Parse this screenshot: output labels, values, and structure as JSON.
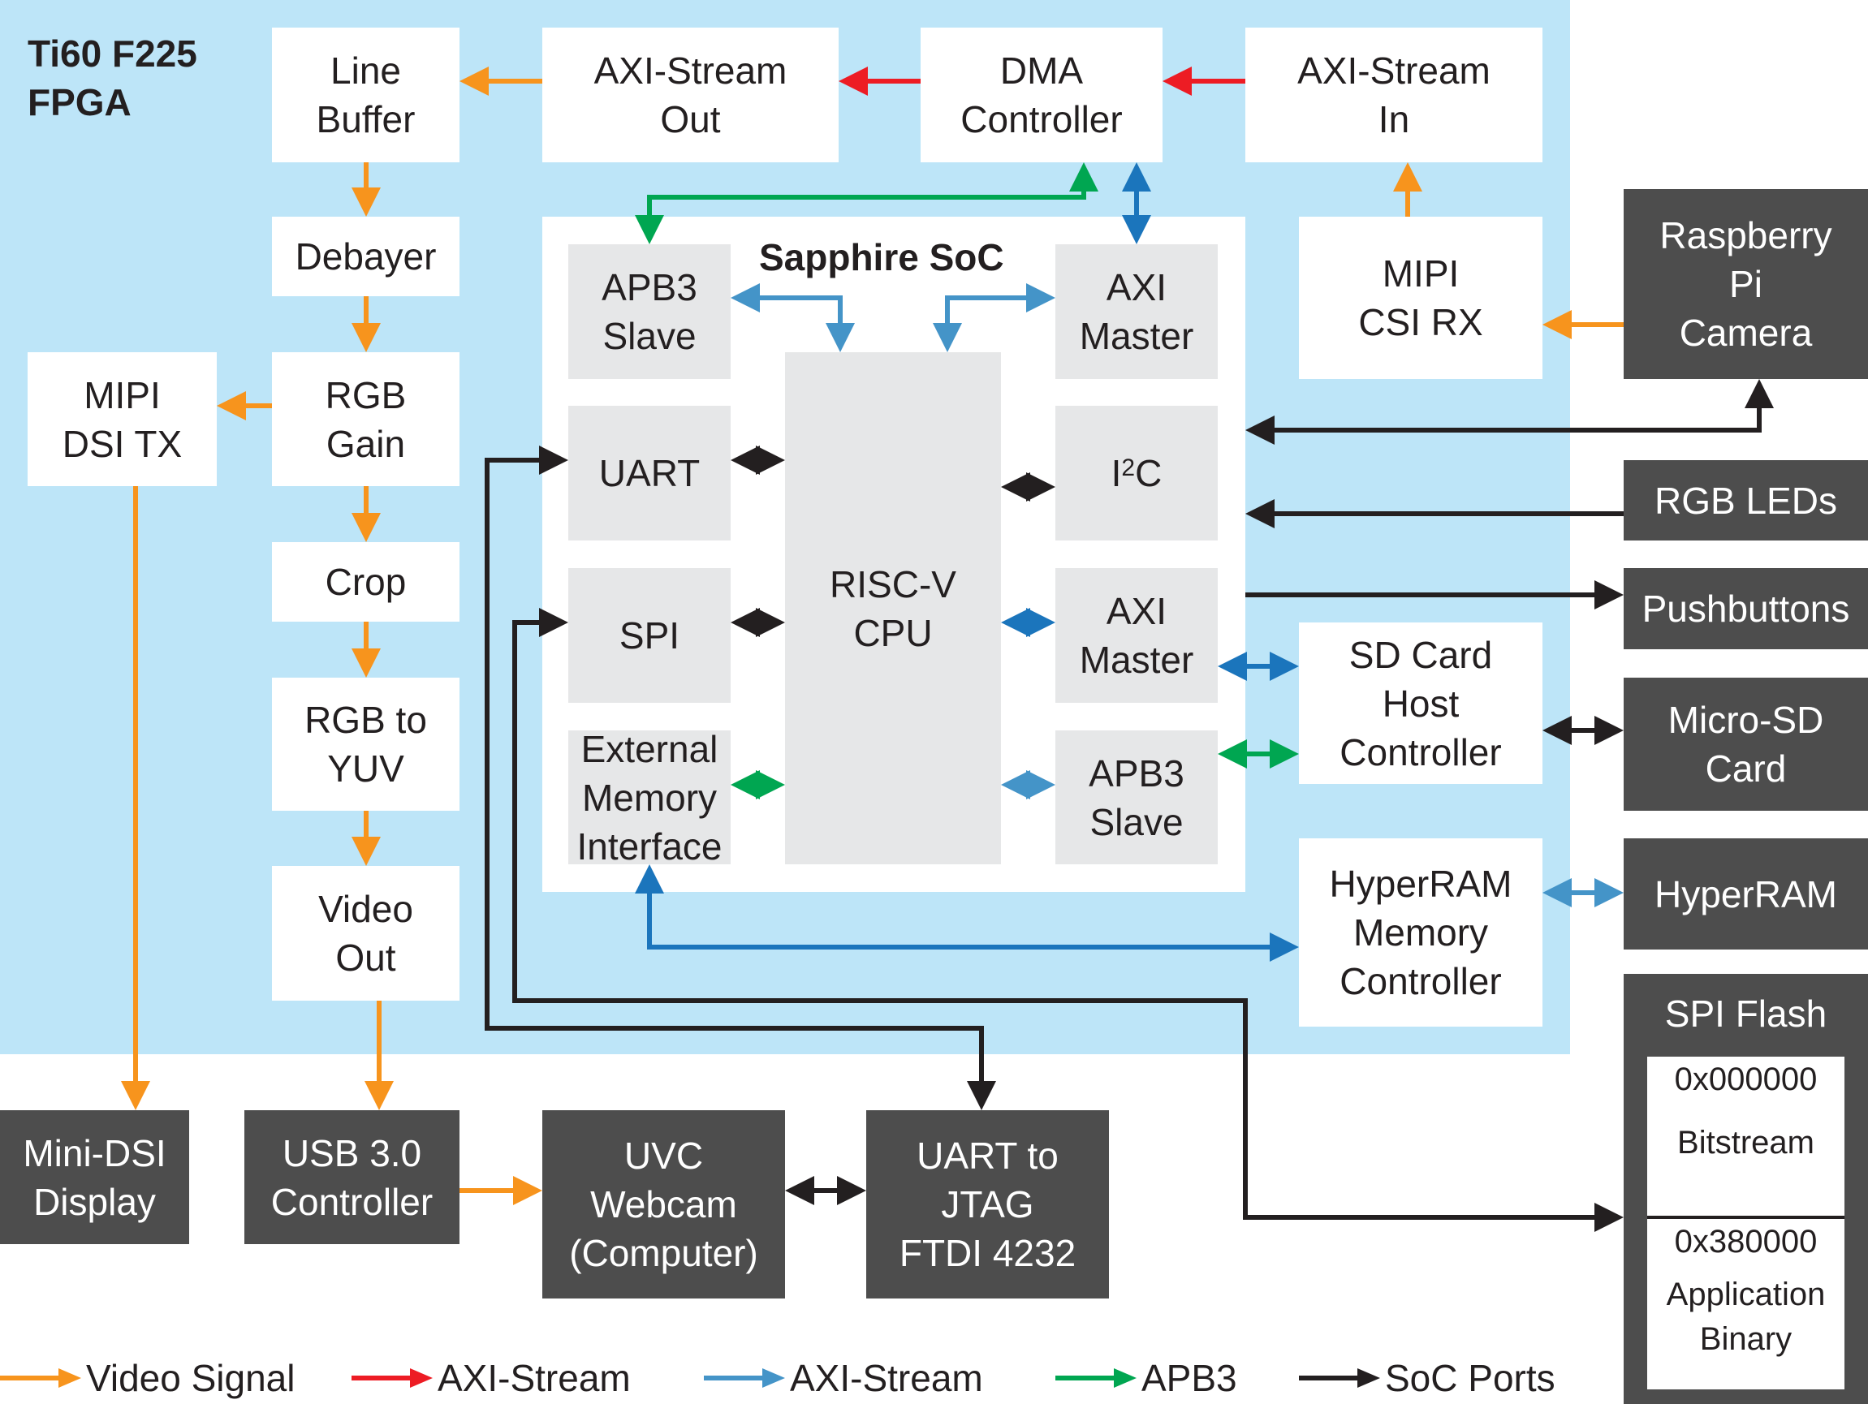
{
  "fpga": {
    "title": "Ti60 F225\nFPGA"
  },
  "soc": {
    "title": "Sapphire SoC"
  },
  "blocks": {
    "line_buffer": "Line\nBuffer",
    "axis_out": "AXI-Stream\nOut",
    "dma": "DMA\nController",
    "axis_in": "AXI-Stream\nIn",
    "debayer": "Debayer",
    "rgb_gain": "RGB\nGain",
    "mipi_dsi_tx": "MIPI\nDSI TX",
    "crop": "Crop",
    "rgb_to_yuv": "RGB to\nYUV",
    "video_out": "Video\nOut",
    "mipi_csi_rx": "MIPI\nCSI RX",
    "sd_host": "SD Card\nHost\nController",
    "hyperram_mc": "HyperRAM\nMemory\nController"
  },
  "soc_blocks": {
    "apb3_slave_top": "APB3\nSlave",
    "axi_master_top": "AXI\nMaster",
    "uart": "UART",
    "i2c_base": "I",
    "i2c_sup": "2",
    "i2c_tail": "C",
    "spi": "SPI",
    "axi_master_mid": "AXI\nMaster",
    "ext_mem": "External\nMemory\nInterface",
    "apb3_slave_bottom": "APB3\nSlave",
    "cpu": "RISC-V\nCPU"
  },
  "external": {
    "rpi_camera": "Raspberry\nPi\nCamera",
    "rgb_leds": "RGB LEDs",
    "pushbuttons": "Pushbuttons",
    "micro_sd": "Micro-SD\nCard",
    "hyperram": "HyperRAM",
    "mini_dsi": "Mini-DSI\nDisplay",
    "usb3": "USB 3.0\nController",
    "uvc": "UVC\nWebcam\n(Computer)",
    "uart_jtag": "UART to\nJTAG\nFTDI 4232"
  },
  "spi_flash": {
    "title": "SPI Flash",
    "region1_addr": "0x000000",
    "region1_label": "Bitstream",
    "region2_addr": "0x380000",
    "region2_label": "Application\nBinary"
  },
  "legend": [
    {
      "label": "Video Signal",
      "color": "#f7941d"
    },
    {
      "label": "AXI-Stream",
      "color": "#ed1c24"
    },
    {
      "label": "AXI-Stream",
      "color": "#3f8fc5"
    },
    {
      "label": "APB3",
      "color": "#00a651"
    },
    {
      "label": "SoC Ports",
      "color": "#231f20"
    }
  ],
  "colors": {
    "video": "#f7941d",
    "axis_red": "#ed1c24",
    "axi_blue": "#1b75bc",
    "axi_light_blue": "#4494c8",
    "apb3": "#00a651",
    "soc_ports": "#231f20",
    "fpga_bg": "#bde5f8",
    "ext_bg": "#4d4d4d"
  }
}
